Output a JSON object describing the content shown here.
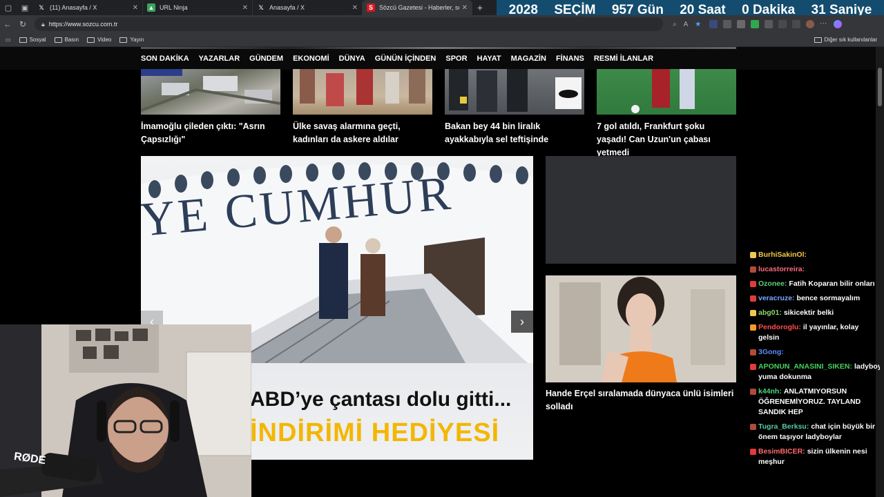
{
  "browser": {
    "tabs": [
      {
        "label": "(11) Anasayfa / X",
        "favicon": "x-icon",
        "active": false
      },
      {
        "label": "URL Ninja",
        "favicon": "url-ninja-icon",
        "active": false
      },
      {
        "label": "Anasayfa / X",
        "favicon": "x-icon",
        "active": false
      },
      {
        "label": "Sözcü Gazetesi - Haberler, son da",
        "favicon": "sozcu-icon",
        "active": true
      }
    ],
    "url": "https://www.sozcu.com.tr",
    "bookmarks": [
      "Sosyal",
      "Basın",
      "Video",
      "Yayın"
    ],
    "bookmarks_right": "Diğer sık kullanılanlar"
  },
  "countdown": {
    "year": "2028",
    "label": "SEÇİM",
    "days": "957 Gün",
    "hours": "20 Saat",
    "minutes": "0 Dakika",
    "seconds": "31 Saniye",
    "bg_color": "#134c6e"
  },
  "nav": {
    "items": [
      "SON DAKİKA",
      "YAZARLAR",
      "GÜNDEM",
      "EKONOMİ",
      "DÜNYA",
      "GÜNÜN İÇİNDEN",
      "SPOR",
      "HAYAT",
      "MAGAZİN",
      "FİNANS",
      "RESMİ İLANLAR"
    ]
  },
  "news_cards": [
    {
      "caption": "İmamoğlu çileden çıktı: \"Asrın Çapsızlığı\""
    },
    {
      "caption": "Ülke savaş alarmına geçti, kadınları da askere aldılar"
    },
    {
      "caption": "Bakan bey 44 bin liralık ayakkabıyla sel teftişinde"
    },
    {
      "caption": "7 gol atıldı, Frankfurt şoku yaşadı! Can Uzun'un çabası yetmedi"
    }
  ],
  "hero": {
    "plane_text": "YE CUMHUR",
    "headline_line1": "ABD’ye çantası dolu gitti...",
    "headline_line2": "İNDİRİMİ HEDİYESİ",
    "headline_color": "#f2b705"
  },
  "side_story": {
    "caption": "Hande Erçel sıralamada dünyaca ünlü isimleri solladı"
  },
  "chat": [
    {
      "user": "BurhiSakinOl:",
      "text": "",
      "color": "#f2c94c",
      "badge": "#f2c94c"
    },
    {
      "user": "lucastorreira:",
      "text": "",
      "color": "#ff6b81",
      "badge": "#b24a3b"
    },
    {
      "user": "Ozonee:",
      "text": "Fatih Koparan bilir onları",
      "color": "#5ad17a",
      "badge": "#e03b3b"
    },
    {
      "user": "veracruze:",
      "text": "bence sormayalım",
      "color": "#7aa7ff",
      "badge": "#e03b3b"
    },
    {
      "user": "abg01:",
      "text": "sikicektir belki",
      "color": "#8fd86b",
      "badge": "#f2c94c"
    },
    {
      "user": "Pendoroglu:",
      "text": "il yayınlar, kolay gelsin",
      "color": "#ff4d4d",
      "badge": "#f29b2c"
    },
    {
      "user": "3Gong:",
      "text": "",
      "color": "#5b8cff",
      "badge": "#b24a3b"
    },
    {
      "user": "APONUN_ANASINI_SIKEN:",
      "text": "ladyboy yuma dokunma",
      "color": "#46d160",
      "badge": "#e03b3b"
    },
    {
      "user": "k44nh:",
      "text": "ANLATMIYORSUN ÖĞRENEMİYORUZ. TAYLAND SANDIK HEP",
      "color": "#4fd67a",
      "badge": "#b24a3b"
    },
    {
      "user": "Tugra_Berksu:",
      "text": "chat için büyük bir önem taşıyor ladyboylar",
      "color": "#56c8a8",
      "badge": "#b24a3b"
    },
    {
      "user": "BesimBICER:",
      "text": "sizin ülkenin nesi meşhur",
      "color": "#ff6b6b",
      "badge": "#e03b3b"
    }
  ],
  "webcam": {
    "mic_brand": "RØDE"
  }
}
